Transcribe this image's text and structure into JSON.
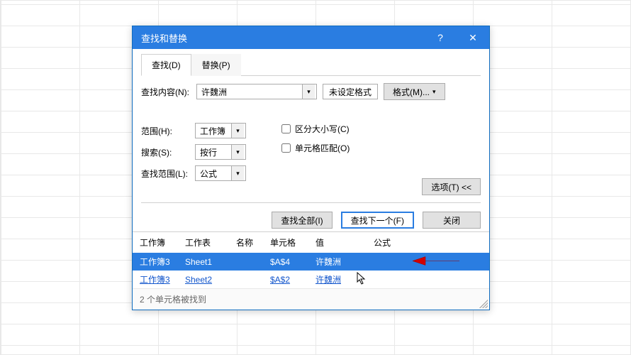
{
  "dialog": {
    "title": "查找和替换",
    "tabs": {
      "find": "查找(D)",
      "replace": "替换(P)"
    },
    "findRow": {
      "label": "查找内容(N):",
      "value": "许魏洲",
      "formatPreview": "未设定格式",
      "formatButton": "格式(M)..."
    },
    "options": {
      "withinLabel": "范围(H):",
      "withinValue": "工作簿",
      "searchLabel": "搜索(S):",
      "searchValue": "按行",
      "lookInLabel": "查找范围(L):",
      "lookInValue": "公式",
      "matchCase": "区分大小写(C)",
      "matchEntire": "单元格匹配(O)",
      "optionsButton": "选项(T) <<"
    },
    "actions": {
      "findAll": "查找全部(I)",
      "findNext": "查找下一个(F)",
      "close": "关闭"
    },
    "results": {
      "headers": {
        "workbook": "工作簿",
        "worksheet": "工作表",
        "name": "名称",
        "cell": "单元格",
        "value": "值",
        "formula": "公式"
      },
      "rows": [
        {
          "workbook": "工作簿3",
          "worksheet": "Sheet1",
          "name": "",
          "cell": "$A$4",
          "value": "许魏洲",
          "formula": ""
        },
        {
          "workbook": "工作簿3",
          "worksheet": "Sheet2",
          "name": "",
          "cell": "$A$2",
          "value": "许魏洲",
          "formula": ""
        }
      ],
      "status": "2 个单元格被找到"
    }
  }
}
